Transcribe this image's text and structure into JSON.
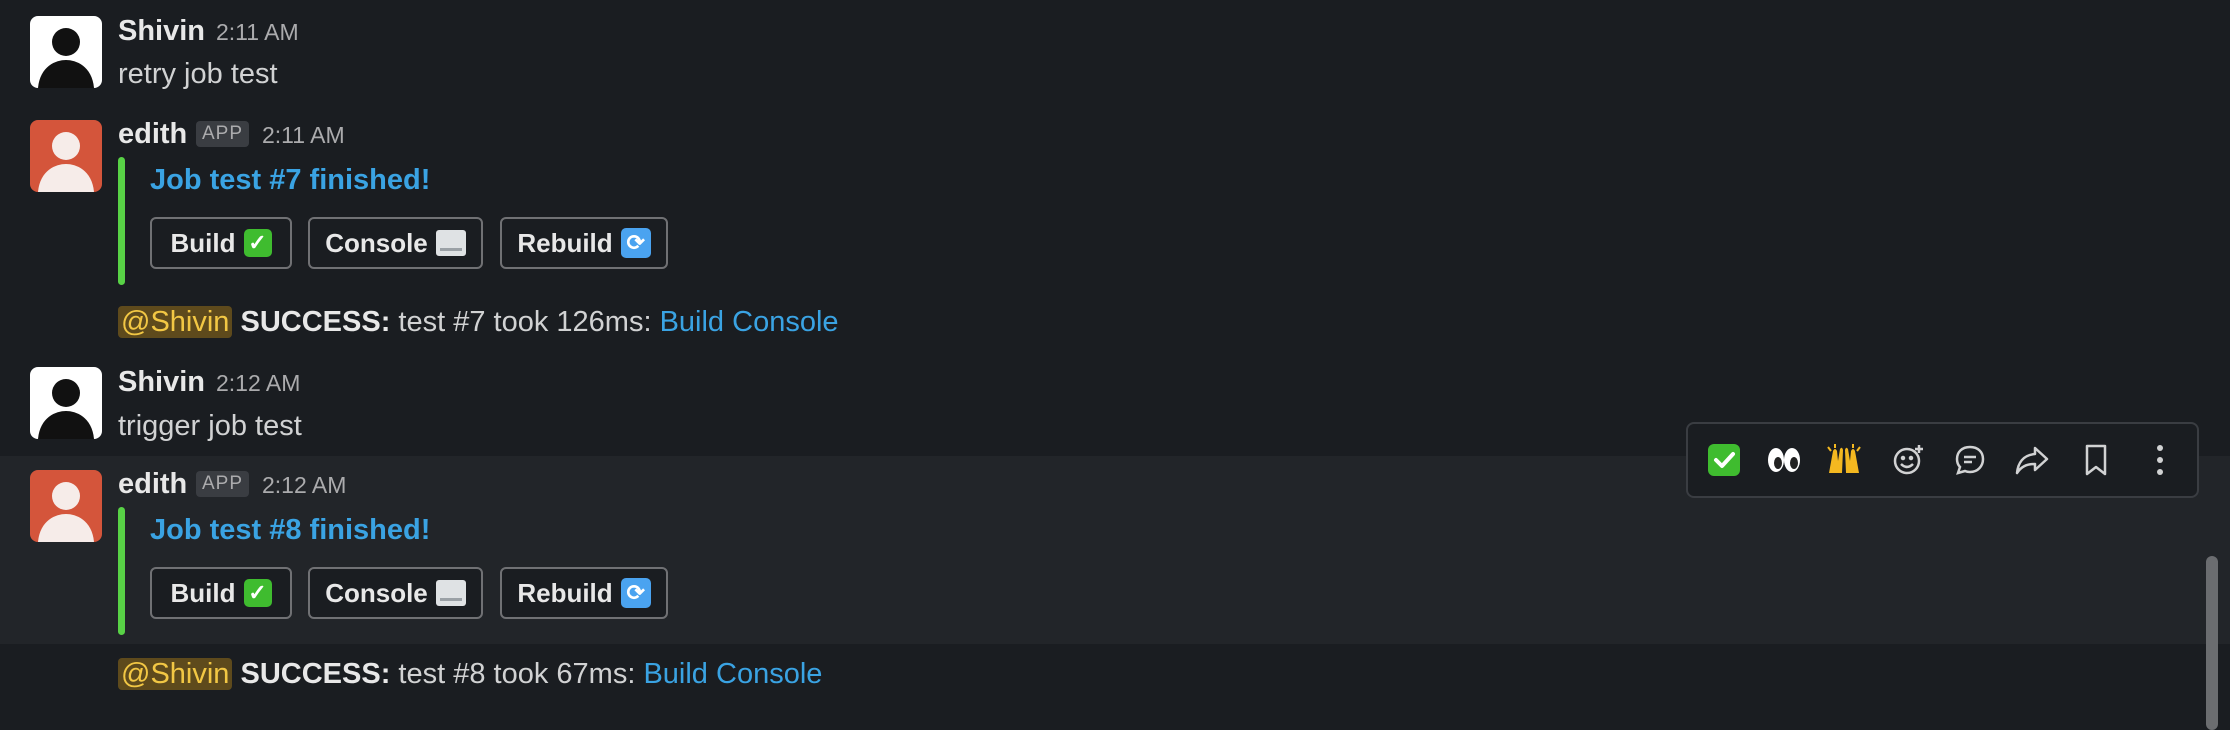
{
  "messages": [
    {
      "author": "Shivin",
      "time": "2:11 AM",
      "text": "retry job test"
    },
    {
      "author": "edith",
      "badge": "APP",
      "time": "2:11 AM",
      "attachment_title": "Job test #7 finished!",
      "buttons": {
        "build": "Build",
        "console": "Console",
        "rebuild": "Rebuild"
      },
      "summary": {
        "mention": "@Shivin",
        "status": "SUCCESS:",
        "detail": " test #7 took 126ms: ",
        "link1": "Build",
        "link2": "Console"
      }
    },
    {
      "author": "Shivin",
      "time": "2:12 AM",
      "text": "trigger job test"
    },
    {
      "author": "edith",
      "badge": "APP",
      "time": "2:12 AM",
      "attachment_title": "Job test #8 finished!",
      "buttons": {
        "build": "Build",
        "console": "Console",
        "rebuild": "Rebuild"
      },
      "summary": {
        "mention": "@Shivin",
        "status": "SUCCESS:",
        "detail": " test #8 took 67ms: ",
        "link1": "Build",
        "link2": "Console"
      }
    }
  ],
  "toolbar": {
    "items": [
      "check-reaction",
      "eyes-reaction",
      "raised-hands-reaction",
      "add-reaction",
      "reply-in-thread",
      "share-message",
      "save-message",
      "more-actions"
    ]
  },
  "colors": {
    "accent": "#3aa3e3",
    "attachment_bar": "#58d246",
    "app_avatar": "#d4553b",
    "mention_bg": "#5e4a1c",
    "mention_fg": "#f2c744"
  }
}
